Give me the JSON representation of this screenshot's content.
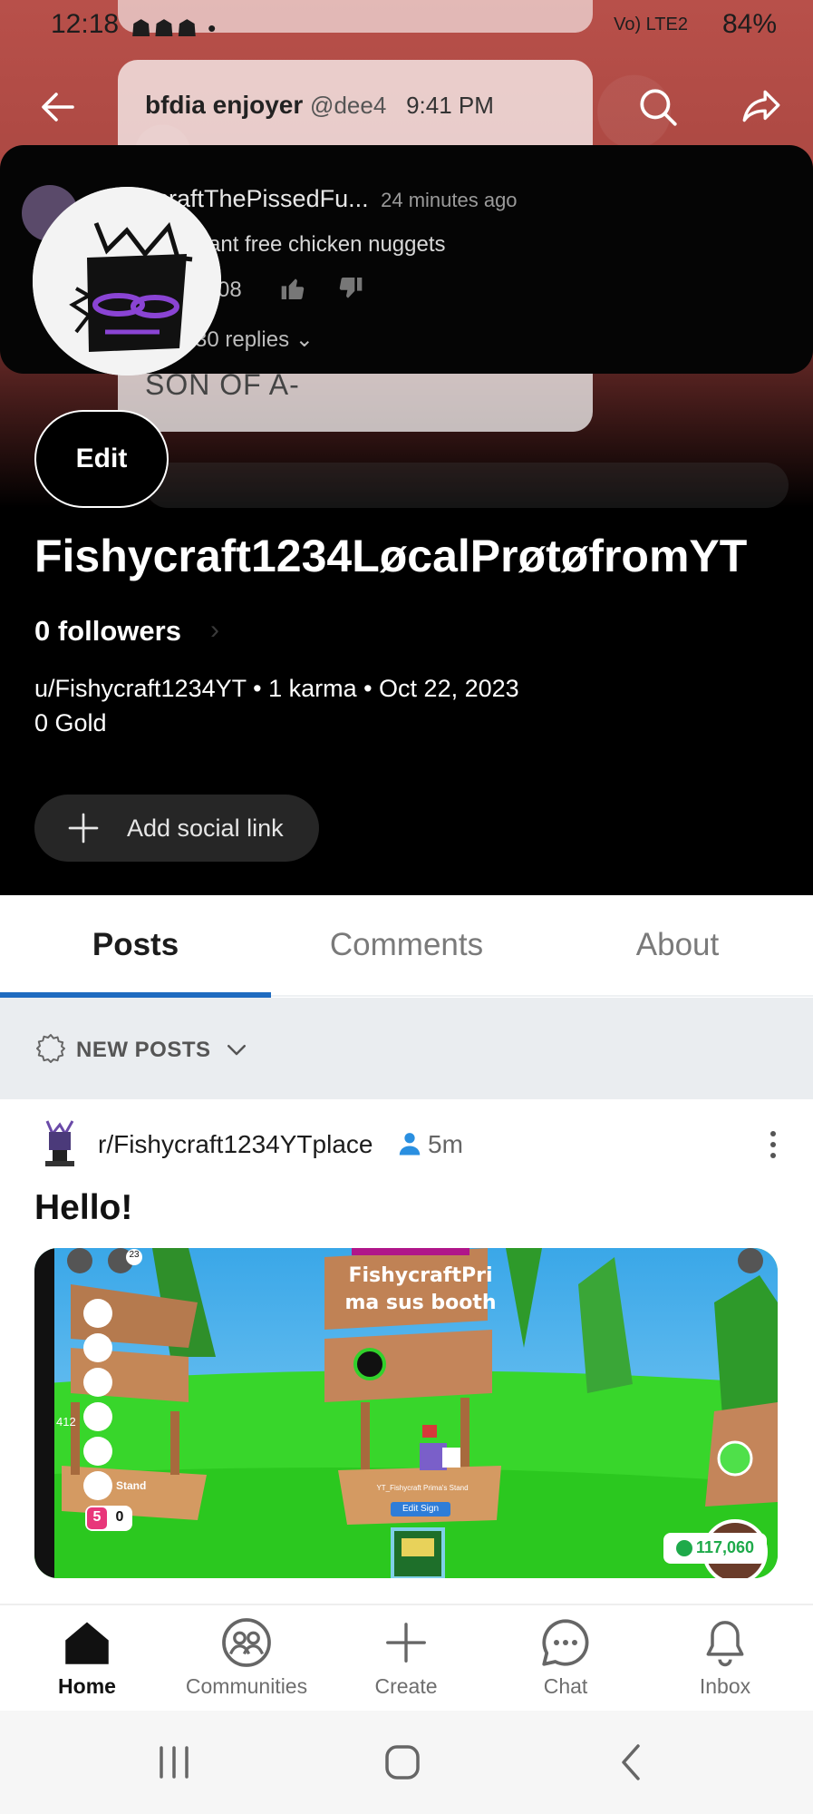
{
  "status_bar": {
    "time": "12:18",
    "notifications": "☗☗☗ •",
    "network": "Vo) LTE2",
    "battery": "84%"
  },
  "banner": {
    "ghost_user": "bfdia enjoyer",
    "ghost_handle": "@dee4",
    "ghost_time": "9:41 PM",
    "ghost_text": "SON OF A-",
    "embed_user": "...craftThePissedFu...",
    "embed_ago": "24 minutes ago",
    "embed_text": "...ant free chicken nuggets",
    "embed_likes": "08",
    "embed_replies": "30 replies"
  },
  "header": {
    "back_icon": "arrow-left-icon",
    "search_icon": "search-icon",
    "share_icon": "share-icon"
  },
  "profile": {
    "edit_label": "Edit",
    "display_name": "Fishycraft1234LøcalPrøtøfromYT",
    "followers": "0 followers",
    "meta": "u/Fishycraft1234YT • 1 karma • Oct 22, 2023",
    "gold": "0 Gold",
    "add_social_label": "Add social link"
  },
  "tabs": [
    {
      "label": "Posts",
      "active": true
    },
    {
      "label": "Comments",
      "active": false
    },
    {
      "label": "About",
      "active": false
    }
  ],
  "sort": {
    "label": "NEW POSTS"
  },
  "post": {
    "subreddit": "r/Fishycraft1234YTplace",
    "age": "5m",
    "title": "Hello!",
    "media": {
      "sign_text_1": "FishycraftPri",
      "sign_text_2": "ma sus booth",
      "edit_sign": "Edit Sign",
      "stand_label": "YT_Fishycraft Prima's Stand",
      "left_stand": "Stand",
      "currency": "117,060",
      "badge_count": "23",
      "side_num": "412",
      "coin_count": "0",
      "coin_value": "5"
    }
  },
  "bottom_nav": [
    {
      "label": "Home",
      "icon": "home-icon",
      "active": true
    },
    {
      "label": "Communities",
      "icon": "communities-icon",
      "active": false
    },
    {
      "label": "Create",
      "icon": "plus-icon",
      "active": false
    },
    {
      "label": "Chat",
      "icon": "chat-icon",
      "active": false
    },
    {
      "label": "Inbox",
      "icon": "bell-icon",
      "active": false
    }
  ],
  "colors": {
    "accent": "#1f6bc0",
    "header_bg": "#000000",
    "banner": "#b8504a",
    "sort_bg": "#eaedf0",
    "user_icon": "#2a8fe0"
  }
}
